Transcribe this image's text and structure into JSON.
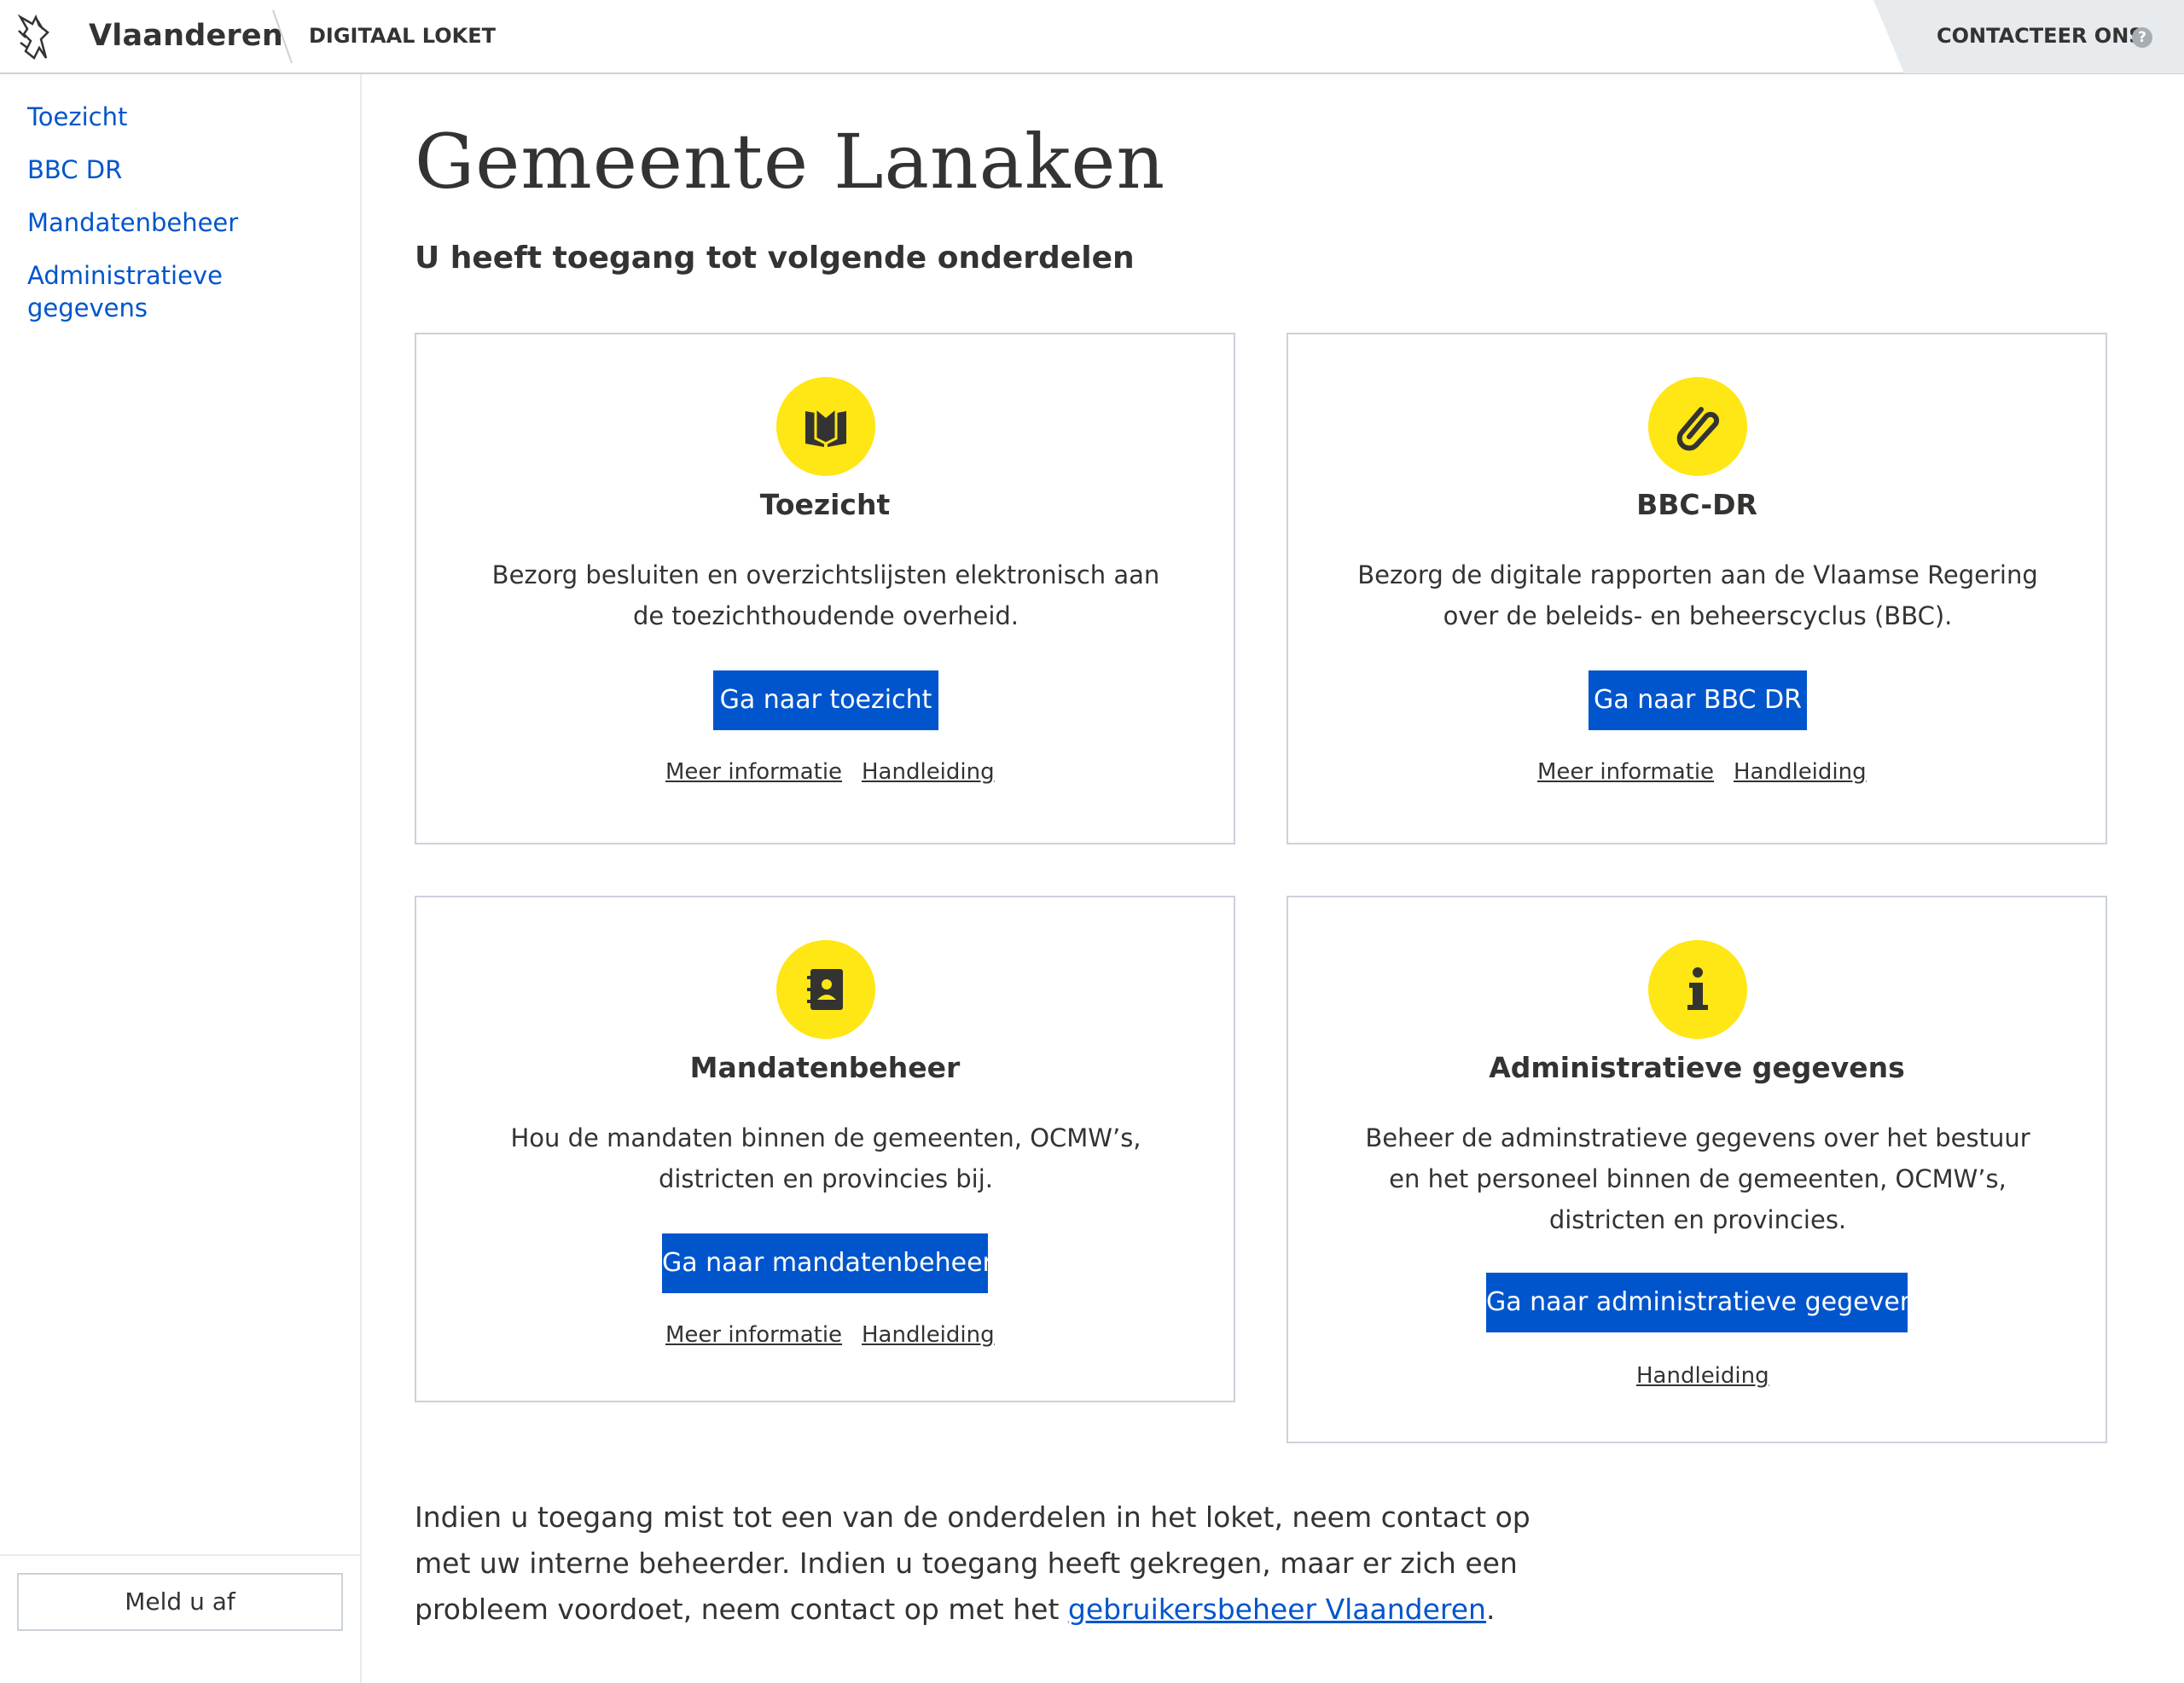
{
  "colors": {
    "accent_blue": "#0055cc",
    "icon_yellow": "#ffe615",
    "border_grey": "#cbd2da",
    "text_dark": "#333332"
  },
  "header": {
    "brand": "Vlaanderen",
    "subbrand": "DIGITAAL LOKET",
    "contact_label": "CONTACTEER ONS",
    "help_icon": "?"
  },
  "sidebar": {
    "items": [
      {
        "label": "Toezicht"
      },
      {
        "label": "BBC DR"
      },
      {
        "label": "Mandatenbeheer"
      },
      {
        "label": "Administratieve gegevens"
      }
    ],
    "logout_label": "Meld u af"
  },
  "main": {
    "title": "Gemeente Lanaken",
    "subtitle": "U heeft toegang tot volgende onderdelen",
    "cards": [
      {
        "icon": "book-icon",
        "title": "Toezicht",
        "description": "Bezorg besluiten en overzichtslijsten elektronisch aan de toezichthoudende overheid.",
        "button": "Ga naar toezicht",
        "links": [
          "Meer informatie",
          "Handleiding"
        ]
      },
      {
        "icon": "paperclip-icon",
        "title": "BBC-DR",
        "description": "Bezorg de digitale rapporten aan de Vlaamse Regering over de beleids- en beheerscyclus (BBC).",
        "button": "Ga naar BBC DR",
        "links": [
          "Meer informatie",
          "Handleiding"
        ]
      },
      {
        "icon": "contact-book-icon",
        "title": "Mandatenbeheer",
        "description": "Hou de mandaten binnen de gemeenten, OCMW’s, districten en provincies bij.",
        "button": "Ga naar mandatenbeheer",
        "links": [
          "Meer informatie",
          "Handleiding"
        ]
      },
      {
        "icon": "info-icon",
        "title": "Administratieve gegevens",
        "description": "Beheer de adminstratieve gegevens over het bestuur en het personeel binnen de gemeenten, OCMW’s, districten en provincies.",
        "button": "Ga naar administratieve gegevens",
        "links": [
          "Handleiding"
        ]
      }
    ],
    "footer": {
      "text_before": "Indien u toegang mist tot een van de onderdelen in het loket, neem contact op met uw interne beheerder. Indien u toegang heeft gekregen, maar er zich een probleem voordoet, neem contact op met het ",
      "link": "gebruikersbeheer Vlaanderen",
      "text_after": "."
    }
  }
}
